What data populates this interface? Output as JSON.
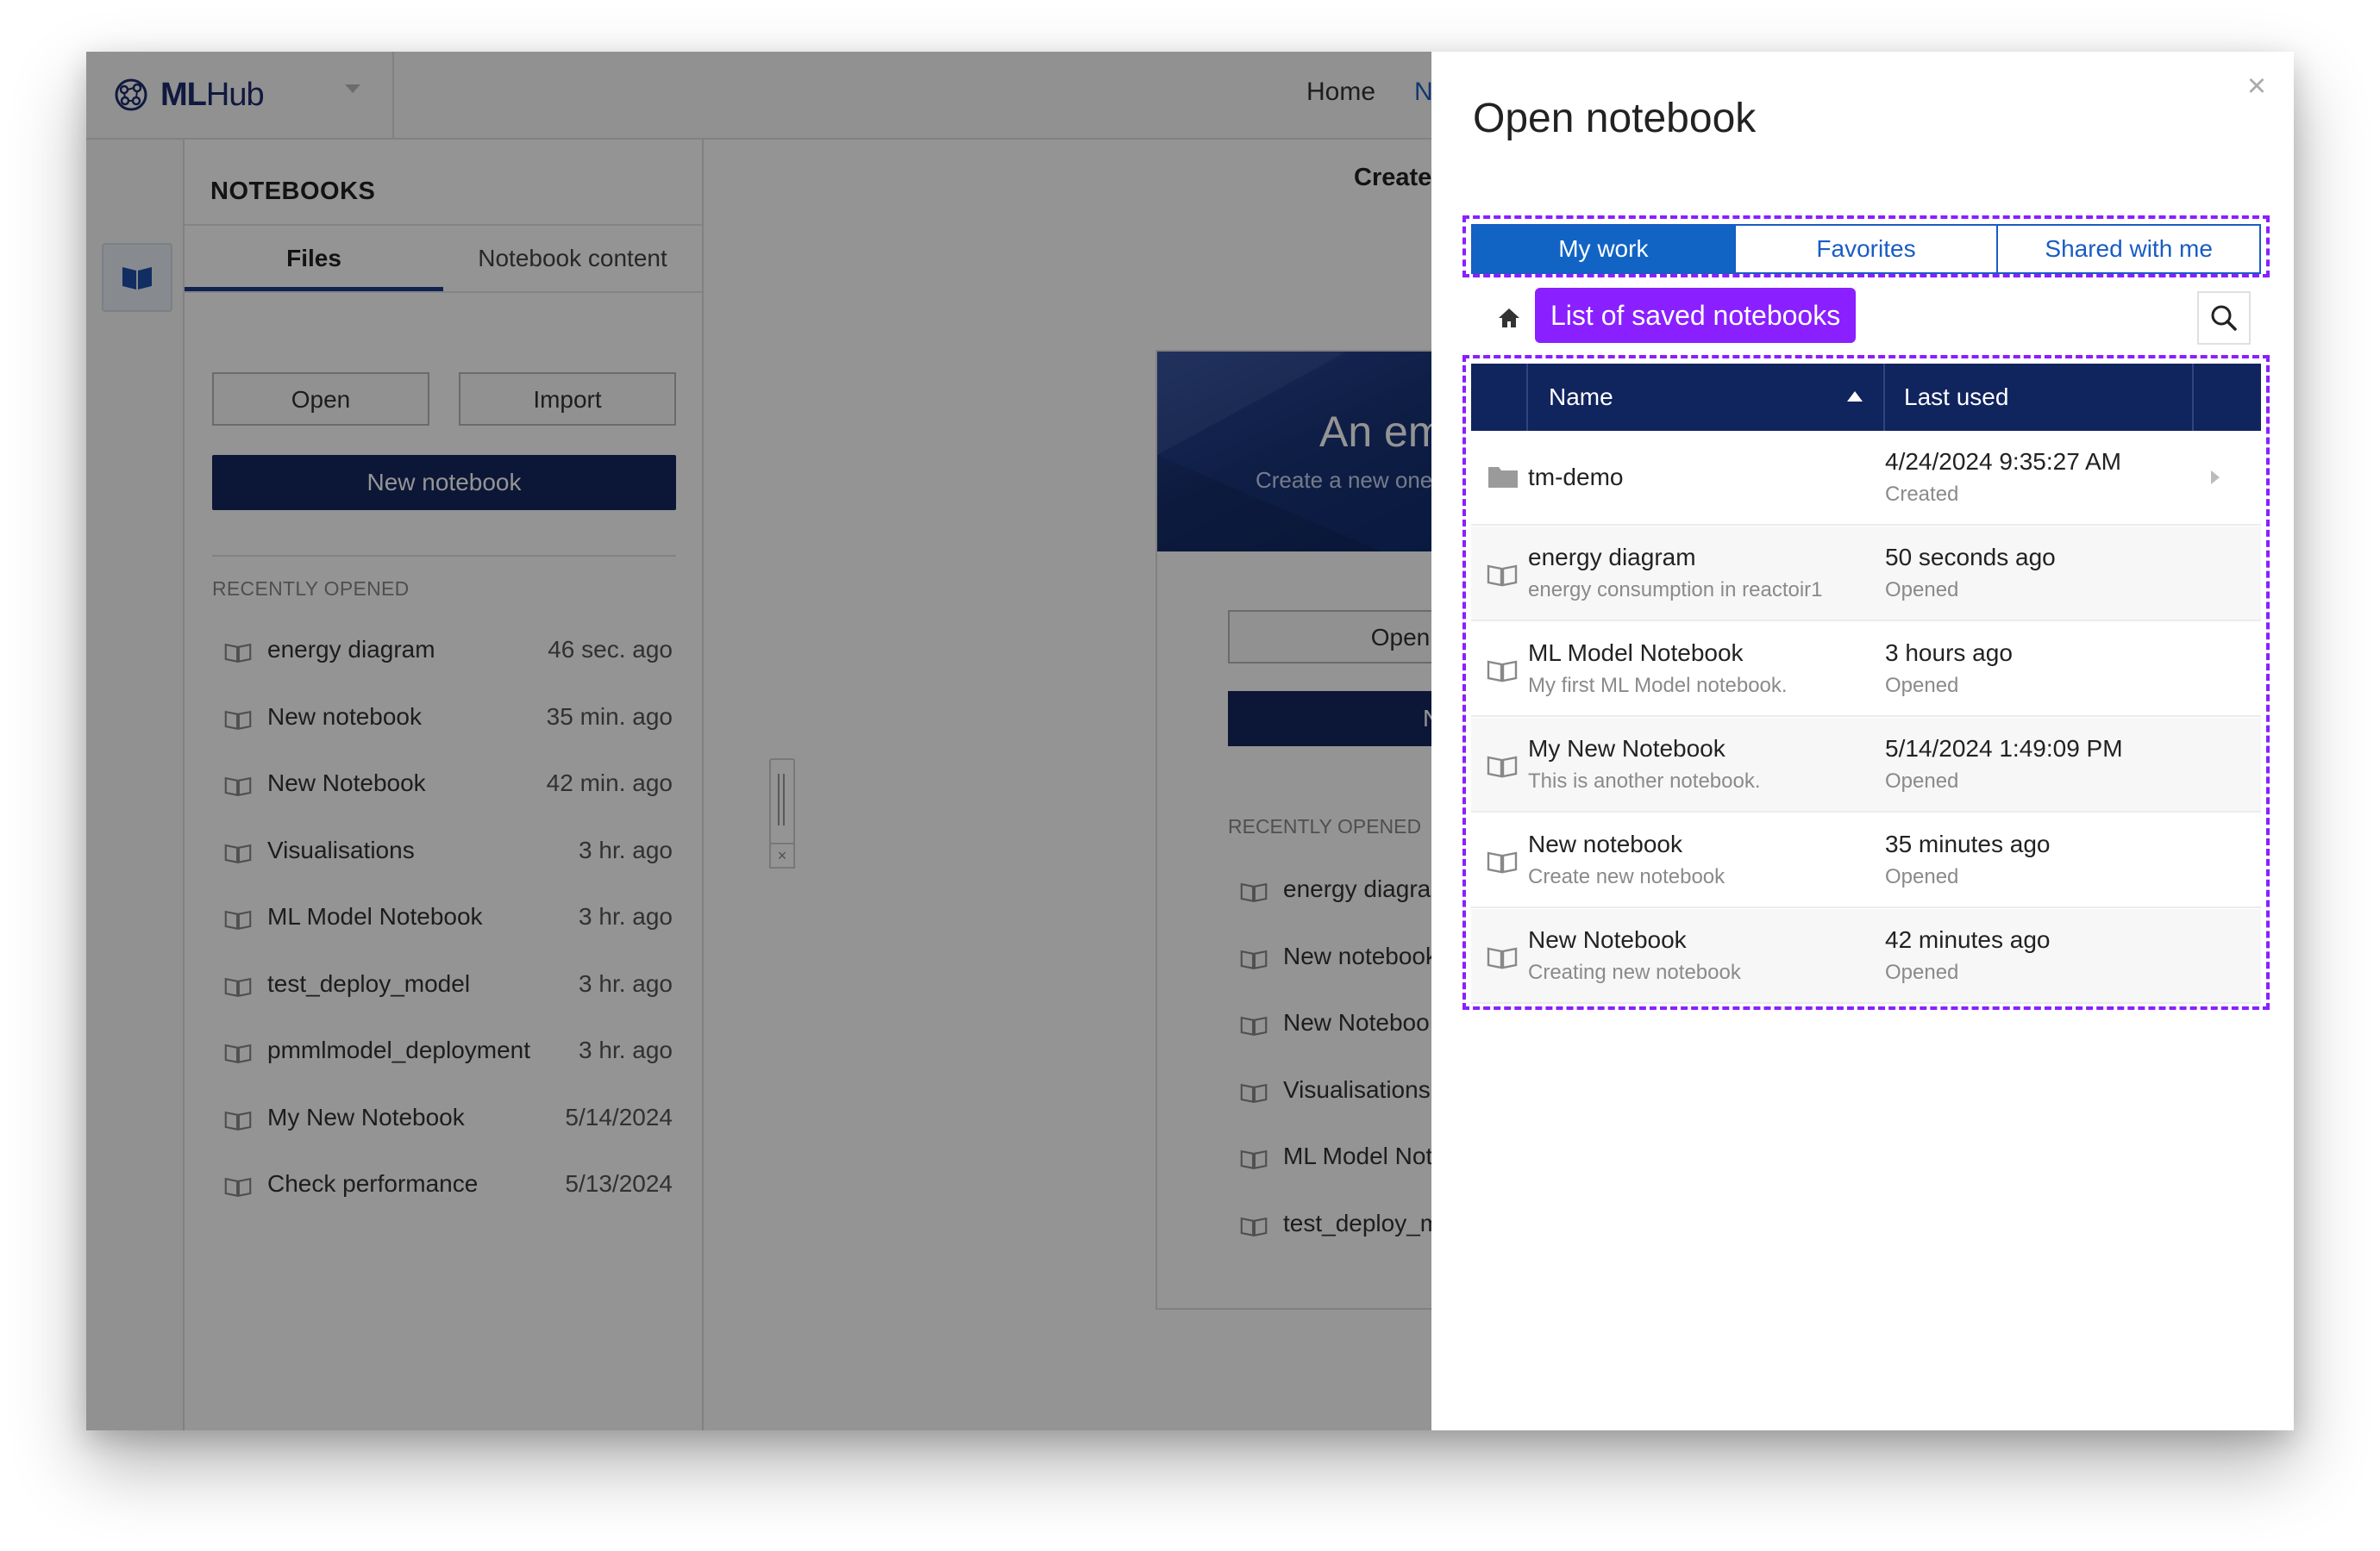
{
  "app": {
    "logo_bold": "ML",
    "logo_light": "Hub",
    "nav": {
      "home": "Home",
      "next_partial": "N"
    }
  },
  "notebooks_panel": {
    "header": "NOTEBOOKS",
    "tabs": [
      "Files",
      "Notebook content"
    ],
    "open_label": "Open",
    "import_label": "Import",
    "new_notebook_label": "New notebook",
    "recent_heading": "RECENTLY OPENED",
    "recent": [
      {
        "name": "energy diagram",
        "time": "46 sec. ago"
      },
      {
        "name": "New notebook",
        "time": "35 min. ago"
      },
      {
        "name": "New Notebook",
        "time": "42 min. ago"
      },
      {
        "name": "Visualisations",
        "time": "3 hr. ago"
      },
      {
        "name": "ML Model Notebook",
        "time": "3 hr. ago"
      },
      {
        "name": "test_deploy_model",
        "time": "3 hr. ago"
      },
      {
        "name": "pmmlmodel_deployment",
        "time": "3 hr. ago"
      },
      {
        "name": "My New Notebook",
        "time": "5/14/2024"
      },
      {
        "name": "Check performance",
        "time": "5/13/2024"
      }
    ]
  },
  "center": {
    "title_partial": "Create c",
    "hero_title_partial": "An em",
    "hero_sub_partial": "Create a new one",
    "open_label": "Open",
    "new_partial": "N",
    "recent_heading": "RECENTLY OPENED",
    "recent_partial": [
      "energy diagram",
      "New notebook",
      "New Noteboo",
      "Visualisations",
      "ML Model Not",
      "test_deploy_m"
    ]
  },
  "dialog": {
    "title": "Open notebook",
    "close_glyph": "×",
    "tabs": [
      {
        "label": "My work",
        "active": true
      },
      {
        "label": "Favorites",
        "active": false
      },
      {
        "label": "Shared with me",
        "active": false
      }
    ],
    "callout": "List of saved notebooks",
    "columns": {
      "name": "Name",
      "last_used": "Last used"
    },
    "rows": [
      {
        "type": "folder",
        "name": "tm-demo",
        "description": "",
        "time": "4/24/2024 9:35:27 AM",
        "status": "Created"
      },
      {
        "type": "notebook",
        "name": "energy diagram",
        "description": "energy consumption in reactoir1",
        "time": "50 seconds ago",
        "status": "Opened"
      },
      {
        "type": "notebook",
        "name": "ML Model Notebook",
        "description": "My first ML Model notebook.",
        "time": "3 hours ago",
        "status": "Opened"
      },
      {
        "type": "notebook",
        "name": "My New Notebook",
        "description": "This is another notebook.",
        "time": "5/14/2024 1:49:09 PM",
        "status": "Opened"
      },
      {
        "type": "notebook",
        "name": "New notebook",
        "description": "Create new notebook",
        "time": "35 minutes ago",
        "status": "Opened"
      },
      {
        "type": "notebook",
        "name": "New Notebook",
        "description": "Creating new notebook",
        "time": "42 minutes ago",
        "status": "Opened"
      }
    ]
  },
  "colors": {
    "brand_navy": "#16275e",
    "table_header": "#10245e",
    "tab_active": "#1164c4",
    "callout_purple": "#8a1fff"
  }
}
